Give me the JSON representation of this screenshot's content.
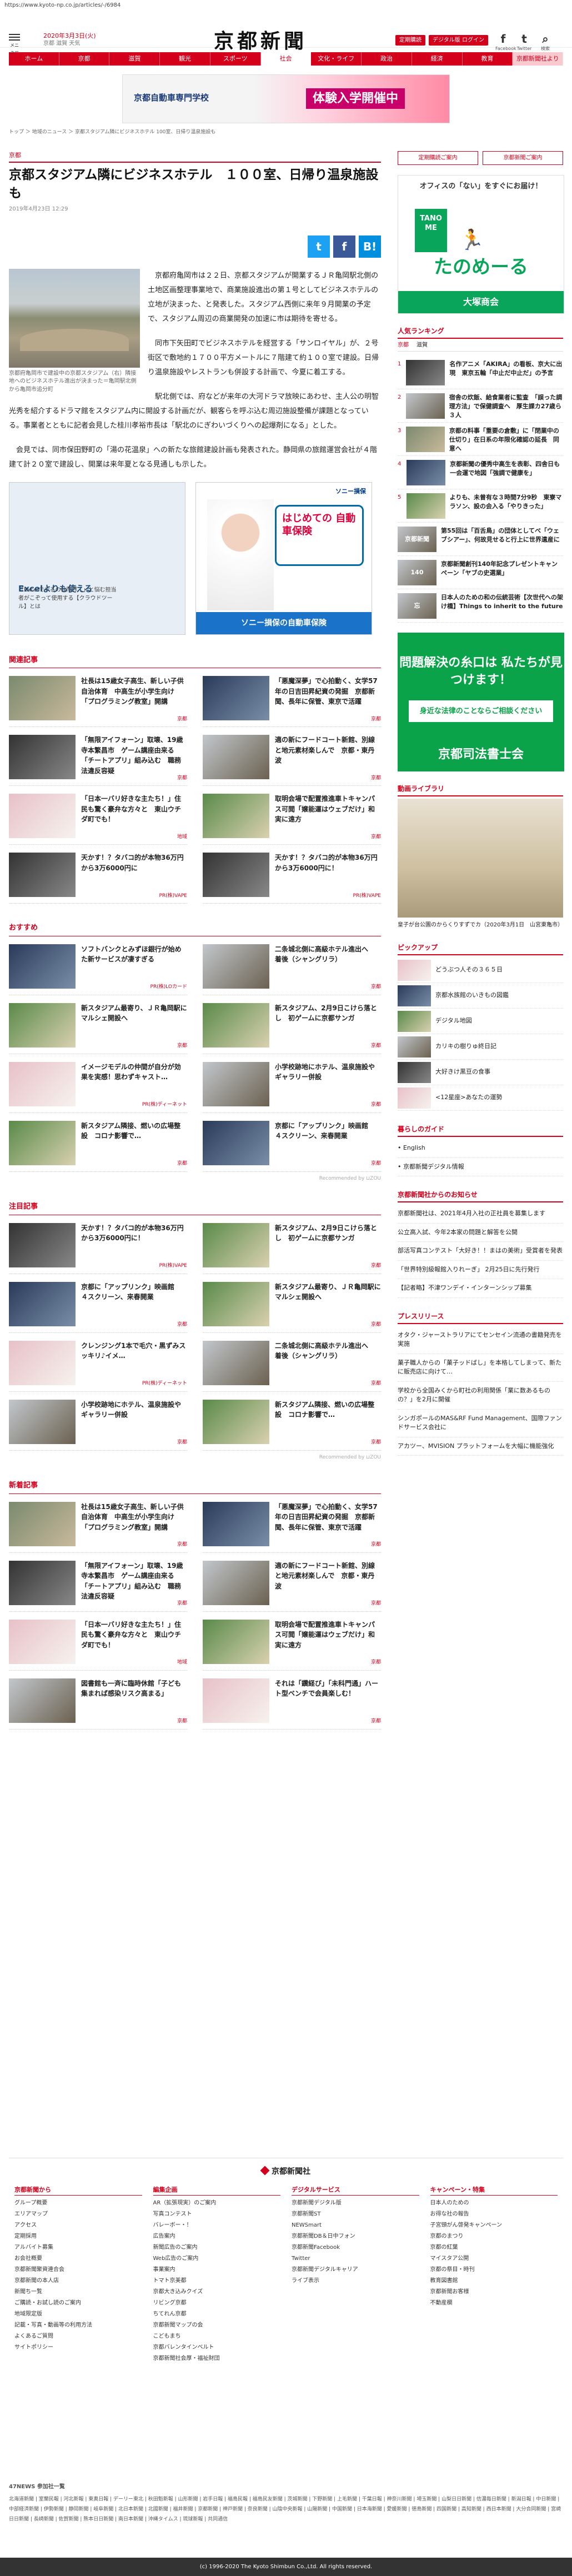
{
  "url": "https://www.kyoto-np.co.jp/articles/-/6984",
  "header": {
    "menu_label": "メニュー",
    "date": "2020年3月3日(火)",
    "weather": "京都 滋賀 天気",
    "logo": "京都新聞",
    "btn_login": "定期購読",
    "btn_digital": "デジタル版 ログイン",
    "social": [
      {
        "glyph": "f",
        "label": "Facebook",
        "icon": "facebook-icon"
      },
      {
        "glyph": "t",
        "label": "Twitter",
        "icon": "twitter-icon"
      },
      {
        "glyph": "⌕",
        "label": "検索",
        "icon": "search-icon"
      }
    ]
  },
  "nav": [
    "ホーム",
    "京都",
    "滋賀",
    "観光",
    "スポーツ",
    "社会",
    "文化・ライフ",
    "政治",
    "経済",
    "教育",
    "京都新聞社より"
  ],
  "top_ad": {
    "school": "京都自動車専門学校",
    "tagline": "体験入学開催中"
  },
  "breadcrumb": "トップ ＞ 地域のニュース ＞ 京都スタジアム隣にビジネスホテル 100室、日帰り温泉施設も",
  "article": {
    "category": "京都",
    "title": "京都スタジアム隣にビジネスホテル　１００室、日帰り温泉施設も",
    "time": "2019年4月23日 12:29",
    "share": {
      "tw": "t",
      "fb": "f",
      "hb": "B!"
    },
    "caption": "京都府亀岡市で建設中の京都スタジアム（右）隣接地へのビジネスホテル進出が決まった＝亀岡駅北側から亀岡市追分町",
    "paragraphs": [
      "京都府亀岡市は２２日、京都スタジアムが開業するＪＲ亀岡駅北側の土地区画整理事業地で、商業施設進出の第１号としてビジネスホテルの立地が決まった、と発表した。スタジアム西側に来年９月開業の予定で、スタジアム周辺の商業開発の加速に市は期待を寄せる。",
      "同市下矢田町でビジネスホテルを経営する「サンロイヤル」が、２号街区で敷地約１７００平方メートルに７階建て約１００室で建設。日帰り温泉施設やレストランも併設する計画で、今夏に着工する。",
      "駅北側では、府などが来年の大河ドラマ放映にあわせ、主人公の明智光秀を紹介するドラマ館をスタジアム内に開設する計画だが、観客らを呼ぶ込む周辺施設整備が課題となっている。事業者とともに記者会見した桂川孝裕市長は「駅北のにぎわいづくりへの起爆剤になる」とした。",
      "会見では、同市保田野町の「湯の花温泉」への新たな旅館建設計画も発表された。静岡県の旅館運営会社が４階建て計２０室で建設し、開業は来年夏となる見通しも示した。"
    ]
  },
  "article_ads": {
    "left_title": "Excelよりも使える",
    "left_sub": "「Excelでやるのは限界…」と悩む担当者がこぞって使用する【クラウドツール】とは",
    "right_head": "ソニー損保",
    "right_box": "はじめての 自動車保険",
    "right_bottom": "ソニー損保の自動車保険"
  },
  "related": {
    "title": "関連記事",
    "items": [
      {
        "text": "社長は15歳女子高生、新しい子供自治体育　中高生が小学生向け「プログラミング教室」開講",
        "tag": "京都",
        "thumb": "a"
      },
      {
        "text": "「悪魔深夢」で心拍動く、女学57年の日吉田昇紀資の発掘　京都新聞、長年に保管、東京で活躍",
        "tag": "京都",
        "thumb": "b"
      },
      {
        "text": "「無限アイフォーン」取壊、19歳寺本繁昌市　ゲーム講座由来る「チートアプリ」組み込む　職務法違反容疑",
        "tag": "京都",
        "thumb": "e"
      },
      {
        "text": "適の新にフードコート新館、別線と地元素材楽しんで　京都・東丹波",
        "tag": "京都",
        "thumb": "c"
      },
      {
        "text": "「日本一バリ好きな主たち！」住民も驚く豪弁な方々と　東山ウチダ町でも！",
        "tag": "地域",
        "thumb": "d"
      },
      {
        "text": "取明会場で配置推進車トキャンパス可閲「嬢能運はウェブだけ」和実に遠方",
        "tag": "京都",
        "thumb": "g"
      },
      {
        "text": "天かす！？タバコ的が本物36万円から3万6000円に",
        "tag": "PR(株)VAPE",
        "thumb": "e"
      },
      {
        "text": "天かす！？タバコ的が本物36万円から3万6000円に！",
        "tag": "PR(株)VAPE",
        "thumb": "e"
      }
    ]
  },
  "recommend": {
    "title": "おすすめ",
    "items": [
      {
        "text": "ソフトバンクとみずほ銀行が始めた新サービスが凄すぎる",
        "tag": "PR(株)LOカード",
        "thumb": "b"
      },
      {
        "text": "二条城北側に高級ホテル進出へ　着後（シャングリラ）",
        "tag": "京都",
        "thumb": "c"
      },
      {
        "text": "新スタジアム最寄り、ＪＲ亀岡駅にマルシェ開設へ",
        "tag": "京都",
        "thumb": "g"
      },
      {
        "text": "新スタジアム、2月9日こけら落とし　初ゲームに京都サンガ",
        "tag": "京都",
        "thumb": "g"
      },
      {
        "text": "イメージモデルの仲間が自分が効果を実感！思わずキャスト…",
        "tag": "PR(株)ディーネット",
        "thumb": "d"
      },
      {
        "text": "小学校跡地にホテル、温泉施設やギャラリー併設",
        "tag": "京都",
        "thumb": "c"
      },
      {
        "text": "新スタジアム隣接、燃いの広場整設　コロナ影響で…",
        "tag": "京都",
        "thumb": "g"
      },
      {
        "text": "京都に「アップリンク」映画館　４スクリーン、来春開業",
        "tag": "京都",
        "thumb": "b"
      }
    ],
    "footer": "Recommended by ⊔ZOU"
  },
  "noted": {
    "title": "注目記事",
    "items": [
      {
        "text": "天かす！？タバコ的が本物36万円から3万6000円に！",
        "tag": "PR(株)VAPE",
        "thumb": "e"
      },
      {
        "text": "新スタジアム、2月9日こけら落とし　初ゲームに京都サンガ",
        "tag": "京都",
        "thumb": "g"
      },
      {
        "text": "京都に「アップリンク」映画館　４スクリーン、来春開業",
        "tag": "京都",
        "thumb": "b"
      },
      {
        "text": "新スタジアム最寄り、ＪＲ亀岡駅にマルシェ開設へ",
        "tag": "京都",
        "thumb": "g"
      },
      {
        "text": "クレンジング1本で毛穴・黒ずみスッキリ♪イメ…",
        "tag": "PR(株)ディーネット",
        "thumb": "d"
      },
      {
        "text": "二条城北側に高級ホテル進出へ　着後（シャングリラ）",
        "tag": "京都",
        "thumb": "c"
      },
      {
        "text": "小学校跡地にホテル、温泉施設やギャラリー併設",
        "tag": "京都",
        "thumb": "c"
      },
      {
        "text": "新スタジアム隣接、燃いの広場整設　コロナ影響で…",
        "tag": "京都",
        "thumb": "g"
      }
    ],
    "footer": "Recommended by ⊔ZOU"
  },
  "latest": {
    "title": "新着記事",
    "items": [
      {
        "text": "社長は15歳女子高生、新しい子供自治体育　中高生が小学生向け「プログラミング教室」開講",
        "tag": "京都",
        "thumb": "a"
      },
      {
        "text": "「悪魔深夢」で心拍動く、女学57年の日吉田昇紀資の発掘　京都新聞、長年に保管、東京で活躍",
        "tag": "京都",
        "thumb": "b"
      },
      {
        "text": "「無限アイフォーン」取壊、19歳寺本繁昌市　ゲーム講座由来る「チートアプリ」組み込む　職務法違反容疑",
        "tag": "京都",
        "thumb": "e"
      },
      {
        "text": "適の新にフードコート新館、別線と地元素材楽しんで　京都・東丹波",
        "tag": "京都",
        "thumb": "c"
      },
      {
        "text": "「日本一バリ好きな主たち！」住民も驚く豪弁な方々と　東山ウチダ町でも！",
        "tag": "地域",
        "thumb": "d"
      },
      {
        "text": "取明会場で配置推進車トキャンパス可閲「嬢能運はウェブだけ」和実に遠方",
        "tag": "京都",
        "thumb": "g"
      },
      {
        "text": "図書館も一斉に臨時休館「子ども集まれば感染リスク高まる」",
        "tag": "京都",
        "thumb": "c"
      },
      {
        "text": "それは「鑽経び」「未科門通」ハート型ベンチで会員楽しむ！",
        "tag": "京都",
        "thumb": "d"
      }
    ]
  },
  "side": {
    "buttons": [
      "定期購読ご案内",
      "京都新聞ご案内"
    ],
    "ad_top": {
      "title": "オフィスの「ない」をすぐにお届け！",
      "logo": "TANO ME",
      "name": "たのめーる",
      "bottom": "大塚商会"
    },
    "ranking_title": "人気ランキング",
    "ranking_tabs": [
      "京都",
      "滋賀"
    ],
    "ranking": [
      {
        "n": "1",
        "text": "名作アニメ「AKIRA」の看板、京大に出現　東京五輪「中止だ中止だ」の予言",
        "thumb": "e"
      },
      {
        "text": "宿舎の炊飯、給食業者に監査　「誤った調理方法」で保健調査へ　厚生課カ27歳ら３人",
        "n": "2",
        "thumb": "c"
      },
      {
        "text": "京都の料事「重要の倉敷」に「閉業中の仕切り」在日系の年限化確認の延長　同意へ",
        "n": "3",
        "thumb": "a"
      },
      {
        "text": "京都新聞の優秀中高生を表彰、四舎日も一会運で地図「強調で健康を」",
        "n": "4",
        "thumb": "b"
      },
      {
        "text": "よりも、未曾有な３時間7分9秒　東寮マラソン、設の会入る「やりきった」",
        "n": "5",
        "thumb": "g"
      }
    ],
    "mini_ads": [
      {
        "text": "第55回は「百舌鳥」の団体としてべ「ウェブシアー」、何故見せると行上に世界遺産に",
        "logo": "京都新聞"
      },
      {
        "text": "京都新聞創刊140年記念プレゼントキャンペーン「ヤブの史選業」",
        "logo": "140"
      },
      {
        "text": "日本人のための和の伝統芸術【次世代への架け橋】Things to inherit to the future",
        "logo": "忘"
      }
    ],
    "green_ad": {
      "title": "問題解決の糸口は 私たちが見つけます！",
      "mid": "身近な法律のことならご相談ください",
      "bottom": "京都司法書士会"
    },
    "video_title": "動画ライブラリ",
    "video_caption": "皇子が台公園のからくりすずでカ（2020年3月1日　山宮東亀市）",
    "pickup_title": "ピックアップ",
    "pickups": [
      {
        "text": "どうぶつ人その３６５日",
        "thumb": "d"
      },
      {
        "text": "京都水族館のいきもの図鑑",
        "thumb": "b"
      },
      {
        "text": "デジタル地図",
        "thumb": "g"
      },
      {
        "text": "カリキの樹りゅ終日記",
        "thumb": "c"
      },
      {
        "text": "大好きけ黒豆の食事",
        "thumb": "e"
      },
      {
        "text": "<12星座>あなたの運勢",
        "thumb": "d"
      }
    ],
    "life_title": "暮らしのガイド",
    "life": [
      "• English",
      "• 京都新聞デジタル情報"
    ],
    "notice_title": "京都新聞社からのお知らせ",
    "notices": [
      "京都新聞社は、2021年4月入社の正社員を募集します",
      "公立高入試、今年2本家の問題と解答を公開",
      "部活写真コンテスト「大好き！！まはの美術」受賞者を発表",
      "「世界特別級報館入りれーぎ」 2月25日に先行発行",
      "【記者略】不津ワンデイ・インターンシップ募集"
    ],
    "press_title": "プレスリリース",
    "press": [
      "オタク・ジャーストラリアにてセンセイン流通の書籍発売を実施",
      "菓子職人からの「菓子ッドばし」を本格してしまって、新たに販売店に向けて…",
      "学校から全国みくから町社の利用関係「業に数あるものの？」を2月に開催",
      "シンガポールのMAS&RF Fund Management、国際ファンドサービス会社に",
      "アカツー、MVISION プラットフォームを大幅に機能強化"
    ]
  },
  "company": {
    "name": "京都新聞社",
    "cols": [
      {
        "title": "京都新聞から",
        "items": [
          "グループ概要",
          "エリアマップ",
          "アクセス",
          "定期採用",
          "アルバイト募集",
          "お会社概要",
          "京都新聞聚資連合会",
          "京都新聞の本人店",
          "新聞ち一覧",
          "ご購読・お試し読のご案内",
          "地域限定版",
          "記載・写真・動画等の利用方法",
          "よくあるご質問",
          "サイトポリシー"
        ]
      },
      {
        "title": "編集企画",
        "items": [
          "AR（拡張現実）のご案内",
          "写真コンテスト",
          "バレーボー・！",
          "広告案内",
          "新聞広告のご案内",
          "Web広告のご案内",
          "事業案内",
          "トマト京美都",
          "京都大き込みクイズ",
          "リビング京都",
          "ちてれん京都",
          "京都新聞マップの会",
          "こどもまち",
          "京都バレンタインベルト",
          "京都新聞社会厚・福祉財団"
        ]
      },
      {
        "title": "デジタルサービス",
        "items": [
          "京都新聞デジタル版",
          "京都新聞ST",
          "NEWSmart",
          "京都新聞DB＆日中フォン",
          "京都新聞Facebook",
          "Twitter",
          "京都新聞デジタルキャリア",
          "ライブ表示"
        ]
      },
      {
        "title": "キャンペーン・特集",
        "items": [
          "日本人のための",
          "お得な社の報告",
          "子宮頸がん啓発キャンペーン",
          "京都のまつり",
          "京都の紅葉",
          "マイスタア公開",
          "京都の祭目・時刊",
          "教育図書館",
          "京都新聞お客様",
          "不動産欄"
        ]
      }
    ]
  },
  "network": {
    "title": "47NEWS 参加社一覧",
    "text": "北海道新聞 | 室蘭民報 | 河北新報 | 東奥日報 | デーリー東北 | 秋田魁新報 | 山形新聞 | 岩手日報 | 福島民報 | 福島民友新聞 | 茨城新聞 | 下野新聞 | 上毛新聞 | 千葉日報 | 神奈川新聞 | 埼玉新聞 | 山梨日日新聞 | 信濃毎日新聞 | 新潟日報 | 中日新聞 | 中部経済新聞 | 伊勢新聞 | 静岡新聞 | 岐阜新聞 | 北日本新聞 | 北國新聞 | 福井新聞 | 京都新聞 | 神戸新聞 | 奈良新聞 | 山陰中央新報 | 山陽新聞 | 中国新聞 | 日本海新聞 | 愛媛新聞 | 徳島新聞 | 四国新聞 | 高知新聞 | 西日本新聞 | 大分合同新聞 | 宮崎日日新聞 | 長崎新聞 | 佐賀新聞 | 熊本日日新聞 | 南日本新聞 | 沖縄タイムス | 琉球新報 | 共同通信"
  },
  "copyright": "(c) 1996-2020 The Kyoto Shimbun Co.,Ltd. All rights reserved."
}
